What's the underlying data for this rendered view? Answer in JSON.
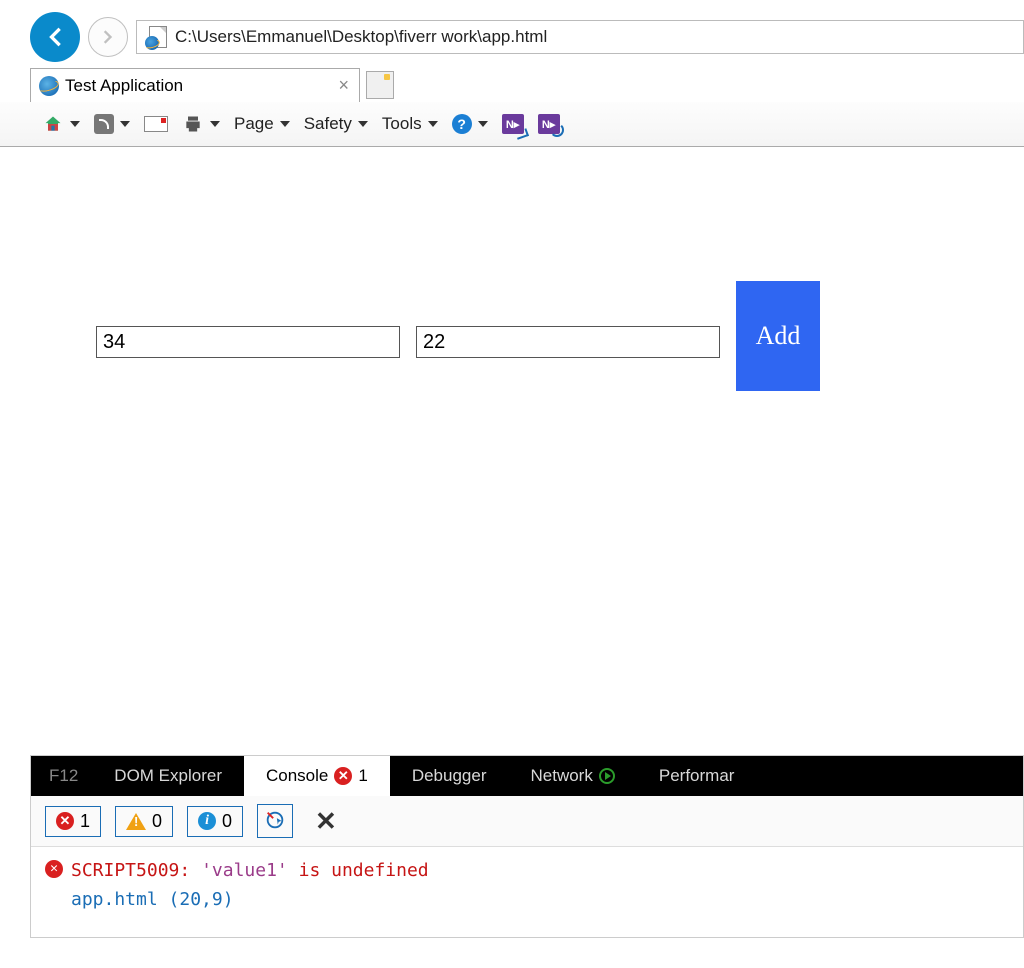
{
  "nav": {
    "url": "C:\\Users\\Emmanuel\\Desktop\\fiverr work\\app.html"
  },
  "tab": {
    "title": "Test Application"
  },
  "cmdbar": {
    "page": "Page",
    "safety": "Safety",
    "tools": "Tools"
  },
  "page": {
    "input1": "34",
    "input2": "22",
    "add_label": "Add"
  },
  "devtools": {
    "tabs": {
      "f12": "F12",
      "dom": "DOM Explorer",
      "console": "Console",
      "console_err_count": "1",
      "debugger": "Debugger",
      "network": "Network",
      "performance": "Performar"
    },
    "filters": {
      "errors": "1",
      "warnings": "0",
      "info": "0"
    },
    "console": {
      "code": "SCRIPT5009:",
      "msg_quoted": "'value1'",
      "msg_rest": " is undefined",
      "location": "app.html (20,9)"
    }
  }
}
